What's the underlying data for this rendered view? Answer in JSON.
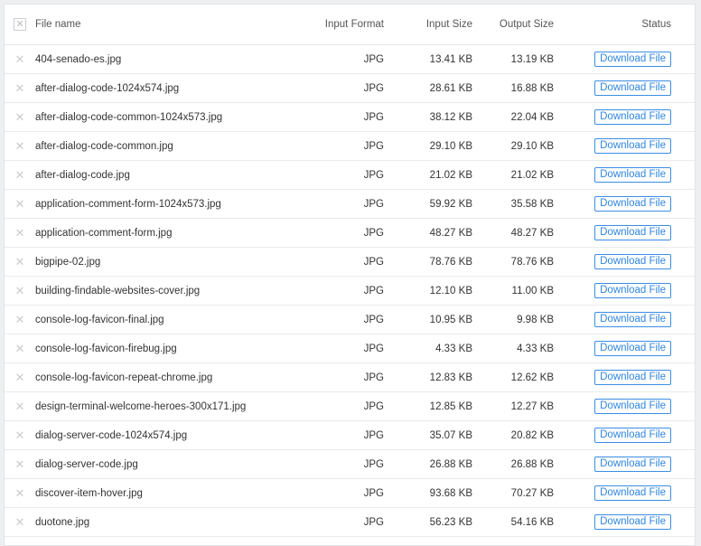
{
  "header": {
    "file_name": "File name",
    "input_format": "Input Format",
    "input_size": "Input Size",
    "output_size": "Output Size",
    "status": "Status"
  },
  "rows": [
    {
      "name": "404-senado-es.jpg",
      "format": "JPG",
      "input": "13.41 KB",
      "output": "13.19 KB",
      "action": "Download File"
    },
    {
      "name": "after-dialog-code-1024x574.jpg",
      "format": "JPG",
      "input": "28.61 KB",
      "output": "16.88 KB",
      "action": "Download File"
    },
    {
      "name": "after-dialog-code-common-1024x573.jpg",
      "format": "JPG",
      "input": "38.12 KB",
      "output": "22.04 KB",
      "action": "Download File"
    },
    {
      "name": "after-dialog-code-common.jpg",
      "format": "JPG",
      "input": "29.10 KB",
      "output": "29.10 KB",
      "action": "Download File"
    },
    {
      "name": "after-dialog-code.jpg",
      "format": "JPG",
      "input": "21.02 KB",
      "output": "21.02 KB",
      "action": "Download File"
    },
    {
      "name": "application-comment-form-1024x573.jpg",
      "format": "JPG",
      "input": "59.92 KB",
      "output": "35.58 KB",
      "action": "Download File"
    },
    {
      "name": "application-comment-form.jpg",
      "format": "JPG",
      "input": "48.27 KB",
      "output": "48.27 KB",
      "action": "Download File"
    },
    {
      "name": "bigpipe-02.jpg",
      "format": "JPG",
      "input": "78.76 KB",
      "output": "78.76 KB",
      "action": "Download File"
    },
    {
      "name": "building-findable-websites-cover.jpg",
      "format": "JPG",
      "input": "12.10 KB",
      "output": "11.00 KB",
      "action": "Download File"
    },
    {
      "name": "console-log-favicon-final.jpg",
      "format": "JPG",
      "input": "10.95 KB",
      "output": "9.98 KB",
      "action": "Download File"
    },
    {
      "name": "console-log-favicon-firebug.jpg",
      "format": "JPG",
      "input": "4.33 KB",
      "output": "4.33 KB",
      "action": "Download File"
    },
    {
      "name": "console-log-favicon-repeat-chrome.jpg",
      "format": "JPG",
      "input": "12.83 KB",
      "output": "12.62 KB",
      "action": "Download File"
    },
    {
      "name": "design-terminal-welcome-heroes-300x171.jpg",
      "format": "JPG",
      "input": "12.85 KB",
      "output": "12.27 KB",
      "action": "Download File"
    },
    {
      "name": "dialog-server-code-1024x574.jpg",
      "format": "JPG",
      "input": "35.07 KB",
      "output": "20.82 KB",
      "action": "Download File"
    },
    {
      "name": "dialog-server-code.jpg",
      "format": "JPG",
      "input": "26.88 KB",
      "output": "26.88 KB",
      "action": "Download File"
    },
    {
      "name": "discover-item-hover.jpg",
      "format": "JPG",
      "input": "93.68 KB",
      "output": "70.27 KB",
      "action": "Download File"
    },
    {
      "name": "duotone.jpg",
      "format": "JPG",
      "input": "56.23 KB",
      "output": "54.16 KB",
      "action": "Download File"
    }
  ]
}
